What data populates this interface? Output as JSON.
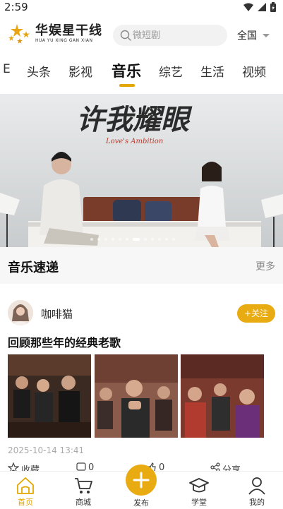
{
  "status_bar": {
    "time": "2:59"
  },
  "header": {
    "logo_title": "华娱星干线",
    "logo_subtitle": "HUA YU XING GAN XIAN",
    "search_placeholder": "微短剧",
    "region": "全国"
  },
  "tabs": [
    {
      "label": "E"
    },
    {
      "label": "头条"
    },
    {
      "label": "影视"
    },
    {
      "label": "音乐",
      "active": true
    },
    {
      "label": "综艺"
    },
    {
      "label": "生活"
    },
    {
      "label": "视频"
    }
  ],
  "banner": {
    "title_art": "许我耀眼",
    "subtitle_art": "Love's Ambition",
    "slide_count": 12,
    "active_slide": 7
  },
  "section": {
    "title": "音乐速递",
    "more": "更多"
  },
  "post": {
    "username": "咖啡猫",
    "follow_label": "+关注",
    "title": "回顾那些年的经典老歌",
    "time": "2025-10-14 13:41"
  },
  "actions": {
    "favorite": "收藏",
    "comment": "0",
    "like": "0",
    "share": "分享"
  },
  "bottom_nav": {
    "home": "首页",
    "shop": "商城",
    "publish": "发布",
    "school": "学堂",
    "mine": "我的"
  },
  "colors": {
    "accent": "#e9ab12",
    "active_text": "#e4a700"
  }
}
